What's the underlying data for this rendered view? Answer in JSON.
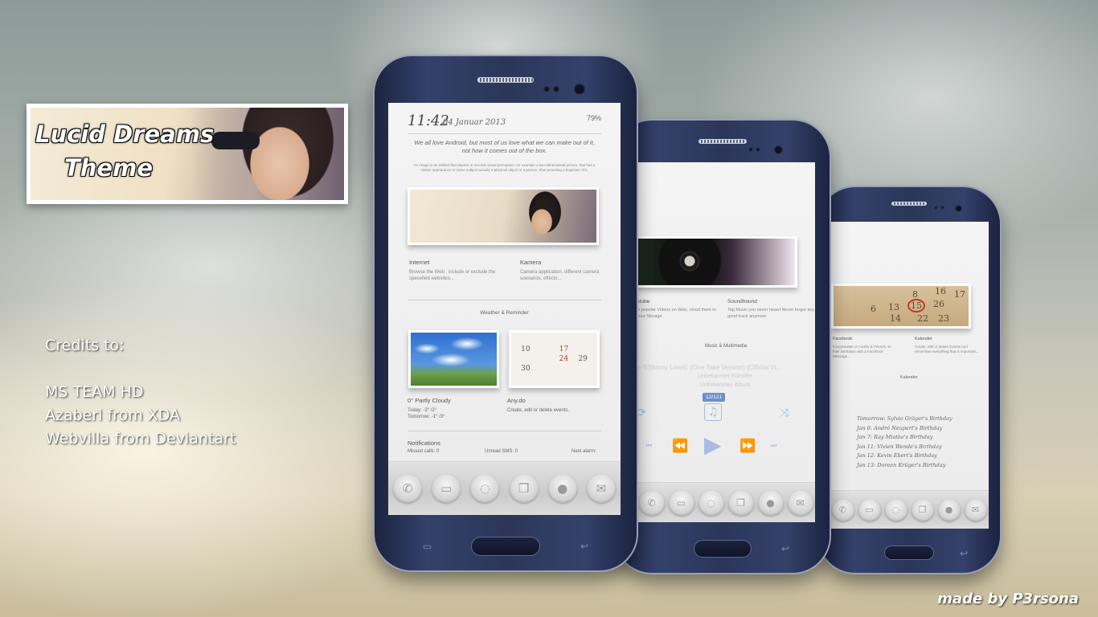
{
  "banner": {
    "title_line1": "Lucid Dreams",
    "title_line2": "Theme"
  },
  "credits": {
    "heading": "Credits to:",
    "names": [
      "MS TEAM HD",
      "Azaberl from XDA",
      "Webvilla from Deviantart"
    ]
  },
  "made_by": "made by P3rsona",
  "phone1": {
    "time": "11:42",
    "date": "04 Januar 2013",
    "battery": "79%",
    "quote": "We all love Android, but most of us love what we can make out of it, not how it comes out of the box.",
    "small_text": "An image is an artifact that depicts or records visual perception, for example a two-dimensional picture, that has a similar appearance to some subject-usually a physical object or a person, thus providing a depiction of it.",
    "internet_title": "Internet",
    "internet_body": "Browse the Web , include or exclude the specefied websites...",
    "camera_title": "Kamera",
    "camera_body": "Camera application, different camera scenarios, effects...",
    "section_weather": "Weather & Reminder",
    "weather_title": "0°  Partly Cloudy",
    "weather_today": "Today:  -3° /2°",
    "weather_tomorrow": "Tomorrow:  -1° /3°",
    "anydo_title": "Any.do",
    "anydo_body": "Create, edit or delete events.",
    "notifications": "Notifications",
    "missed_calls": "Missed calls: 0",
    "unread_sms": "Unread SMS: 0",
    "next_alarm": "Next alarm:",
    "calendar_numbers": [
      "10",
      "",
      "17",
      "",
      "",
      "",
      "24",
      "29",
      "30",
      "",
      "",
      ""
    ]
  },
  "phone2": {
    "youtube_title": "utube",
    "youtube_body": "w popular Videos on Web, nload them to your Storage",
    "soundhound_title": "Soundhound",
    "soundhound_body": "Tag Music you never heard Never forget any good track anymore",
    "section_music": "Music & Multimedia",
    "track": "y- 5'Skinny Love5' (One Take Version) (Official Vi...",
    "artist": "Unbekannter Künstler",
    "album": "Unbekanntes Album",
    "counter": "12/121"
  },
  "phone3": {
    "facebook_title": "Facebook",
    "facebook_body": "Congratulate ur Family & Friends, to their Birthdays with a Facebook Message...",
    "kalender_title": "Kalender",
    "kalender_body": "Create, edit or delete Events and remember everything that is important...",
    "section_kalender": "Kalender",
    "events": [
      "Tomorrow: Sylvio Gröger's Birthday",
      "Jan 6: André Neupert's Birthday",
      "Jan 7: Ray Miatke's Birthday",
      "Jan 11: Vivien Wende's Birthday",
      "Jan 12: Kevin Ebert's Birthday",
      "Jan 13: Doreen Krüger's Birthday"
    ],
    "calendar_numbers": [
      "8",
      "16",
      "17",
      "6",
      "13",
      "14",
      "15",
      "26",
      "22",
      "23"
    ]
  },
  "dock_icons": [
    "phone-icon",
    "messages-icon",
    "whatsapp-icon",
    "chat-icon",
    "contacts-icon",
    "mail-icon"
  ]
}
